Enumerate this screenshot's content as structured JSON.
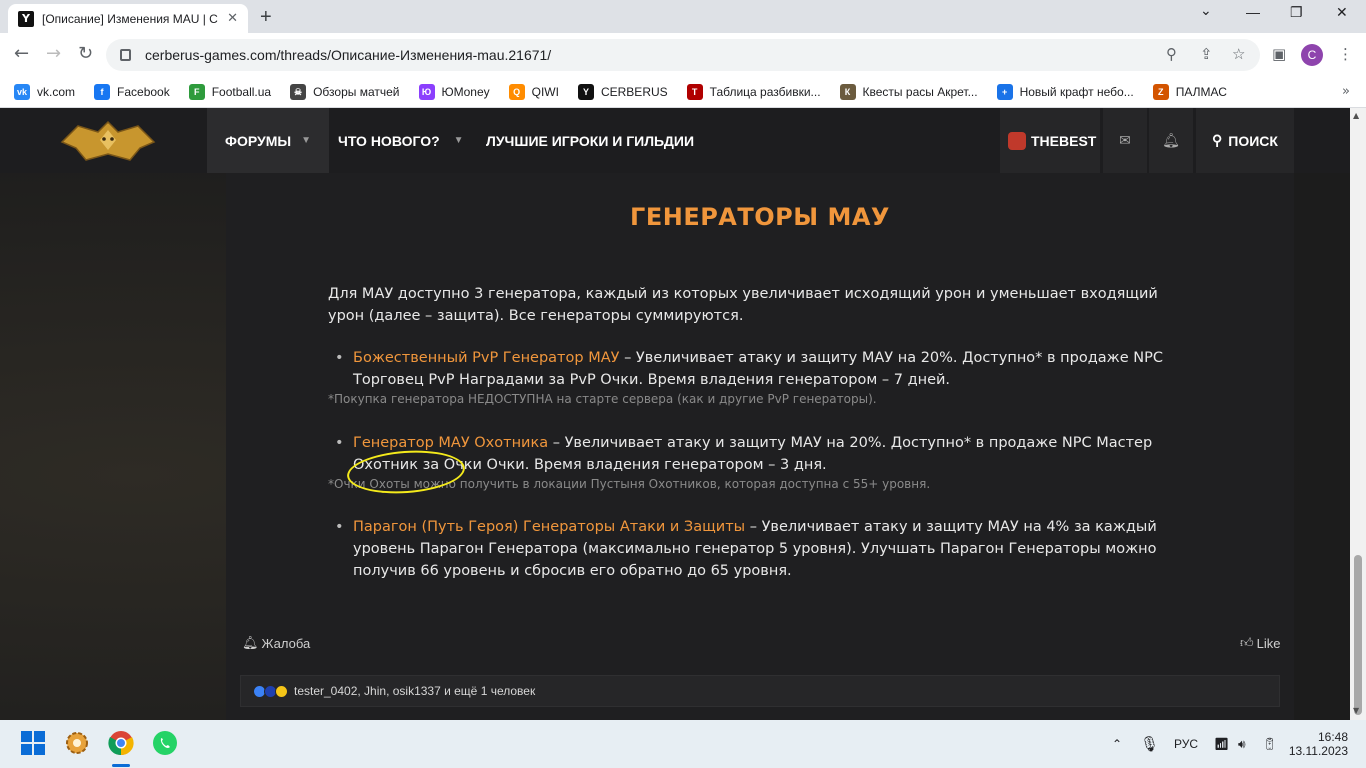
{
  "browser": {
    "tab_title": "[Описание] Изменения MAU | C",
    "tab_favicon": "Y",
    "new_tab_icon": "+",
    "url": "cerberus-games.com/threads/Описание-Изменения-mau.21671/",
    "profile_initial": "C",
    "bookmarks": [
      {
        "label": "vk.com",
        "color": "#2787f5",
        "glyph": "vk"
      },
      {
        "label": "Facebook",
        "color": "#1877f2",
        "glyph": "f"
      },
      {
        "label": "Football.ua",
        "color": "#2e9b3c",
        "glyph": "F"
      },
      {
        "label": "Обзоры матчей",
        "color": "#444444",
        "glyph": "☠"
      },
      {
        "label": "ЮMoney",
        "color": "#8b3ffd",
        "glyph": "Ю"
      },
      {
        "label": "QIWI",
        "color": "#ff8c00",
        "glyph": "Q"
      },
      {
        "label": "CERBERUS",
        "color": "#111111",
        "glyph": "Y"
      },
      {
        "label": "Таблица разбивки...",
        "color": "#b00000",
        "glyph": "T"
      },
      {
        "label": "Квесты расы Акрет...",
        "color": "#6b5b3e",
        "glyph": "К"
      },
      {
        "label": "Новый крафт небо...",
        "color": "#1a73e8",
        "glyph": "+"
      },
      {
        "label": "ПАЛМАС",
        "color": "#d35400",
        "glyph": "Z"
      }
    ],
    "bookmarks_more_icon": "»"
  },
  "site": {
    "nav": {
      "forums": "ФОРУМЫ",
      "whats_new": "ЧТО НОВОГО?",
      "top_players": "ЛУЧШИЕ ИГРОКИ И ГИЛЬДИИ",
      "user": "THEBEST",
      "search": "ПОИСК"
    },
    "post": {
      "title": "ГЕНЕРАТОРЫ МАУ",
      "intro": "Для МАУ доступно 3 генератора, каждый из которых увеличивает исходящий урон и уменьшает входящий урон (далее – защита). Все генераторы суммируются.",
      "items": [
        {
          "name": "Божественный PvP Генератор МАУ",
          "text": " – Увеличивает атаку и защиту МАУ на 20%. Доступно* в продаже NPC Торговец PvP Наградами за PvP Очки. Время владения генератором – 7 дней.",
          "note": "*Покупка генератора НЕДОСТУПНА на старте сервера (как и другие PvP генераторы)."
        },
        {
          "name": "Генератор МАУ Охотника",
          "text": " – Увеличивает атаку и защиту МАУ на 20%. Доступно* в продаже NPC Мастер Охотник за Очки Очки. Время владения генератором – 3 дня.",
          "note": "*Очки Охоты можно получить в локации Пустыня Охотников, которая доступна с 55+ уровня."
        },
        {
          "name": "Парагон (Путь Героя) Генераторы Атаки и Защиты",
          "text": " – Увеличивает атаку и защиту МАУ на 4% за каждый уровень Парагон Генератора (максимально генератор 5 уровня). Улучшать Парагон Генераторы можно получив 66 уровень и сбросив его обратно до 65 уровня.",
          "note": ""
        }
      ],
      "report_label": "Жалоба",
      "like_label": "Like",
      "reactions_text": "tester_0402, Jhin, osik1337 и ещё 1 человек"
    },
    "accent_color": "#f0963c"
  },
  "taskbar": {
    "language": "РУС",
    "time": "16:48",
    "date": "13.11.2023"
  }
}
